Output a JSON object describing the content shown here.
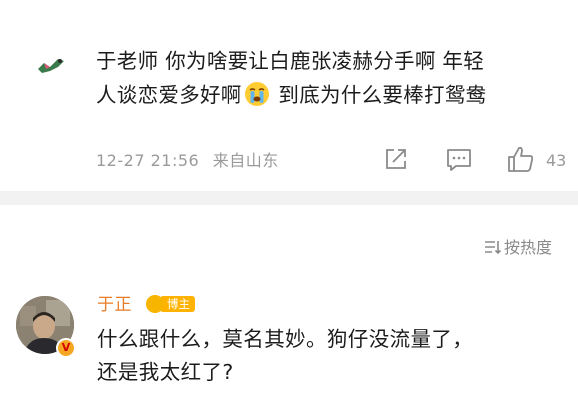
{
  "comment": {
    "line1": "于老师 你为啥要让白鹿张凌赫分手啊 年轻",
    "line2_before": "人谈恋爱多好啊",
    "emoji": "crying-face-icon",
    "line2_after": " 到底为什么要棒打鸳鸯",
    "timestamp": "12-27 21:56",
    "location": "来自山东",
    "like_count": "43"
  },
  "sort": {
    "label": "按热度"
  },
  "reply": {
    "author": "于正",
    "badge": "博主",
    "line1": "什么跟什么，莫名其妙。狗仔没流量了，",
    "line2": "还是我太红了?"
  },
  "colors": {
    "text": "#1c1c1c",
    "meta": "#9a9a9a",
    "author": "#e87c27",
    "badge": "#ffb300",
    "divider": "#f2f2f2"
  }
}
